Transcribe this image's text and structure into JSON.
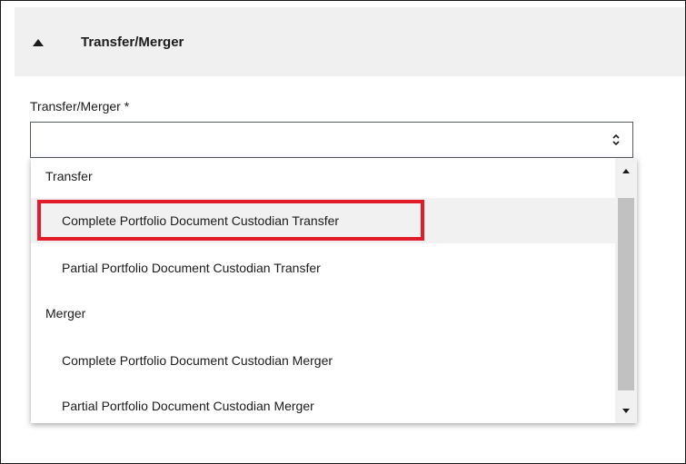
{
  "section": {
    "title": "Transfer/Merger",
    "collapse_icon": "triangle-up-icon"
  },
  "field": {
    "label": "Transfer/Merger *",
    "value": "",
    "arrows_icon": "up-down-chevron-icon"
  },
  "dropdown": {
    "groups": [
      {
        "label": "Transfer",
        "options": [
          "Complete Portfolio Document Custodian Transfer",
          "Partial Portfolio Document Custodian Transfer"
        ]
      },
      {
        "label": "Merger",
        "options": [
          "Complete Portfolio Document Custodian Merger",
          "Partial Portfolio Document Custodian Merger"
        ]
      }
    ],
    "hovered_option": "Complete Portfolio Document Custodian Transfer"
  },
  "colors": {
    "header_bg": "#f0f0f0",
    "hover_bg": "#f1f1f1",
    "highlight_border": "#e21b2a",
    "scroll_thumb": "#c1c1c1"
  }
}
